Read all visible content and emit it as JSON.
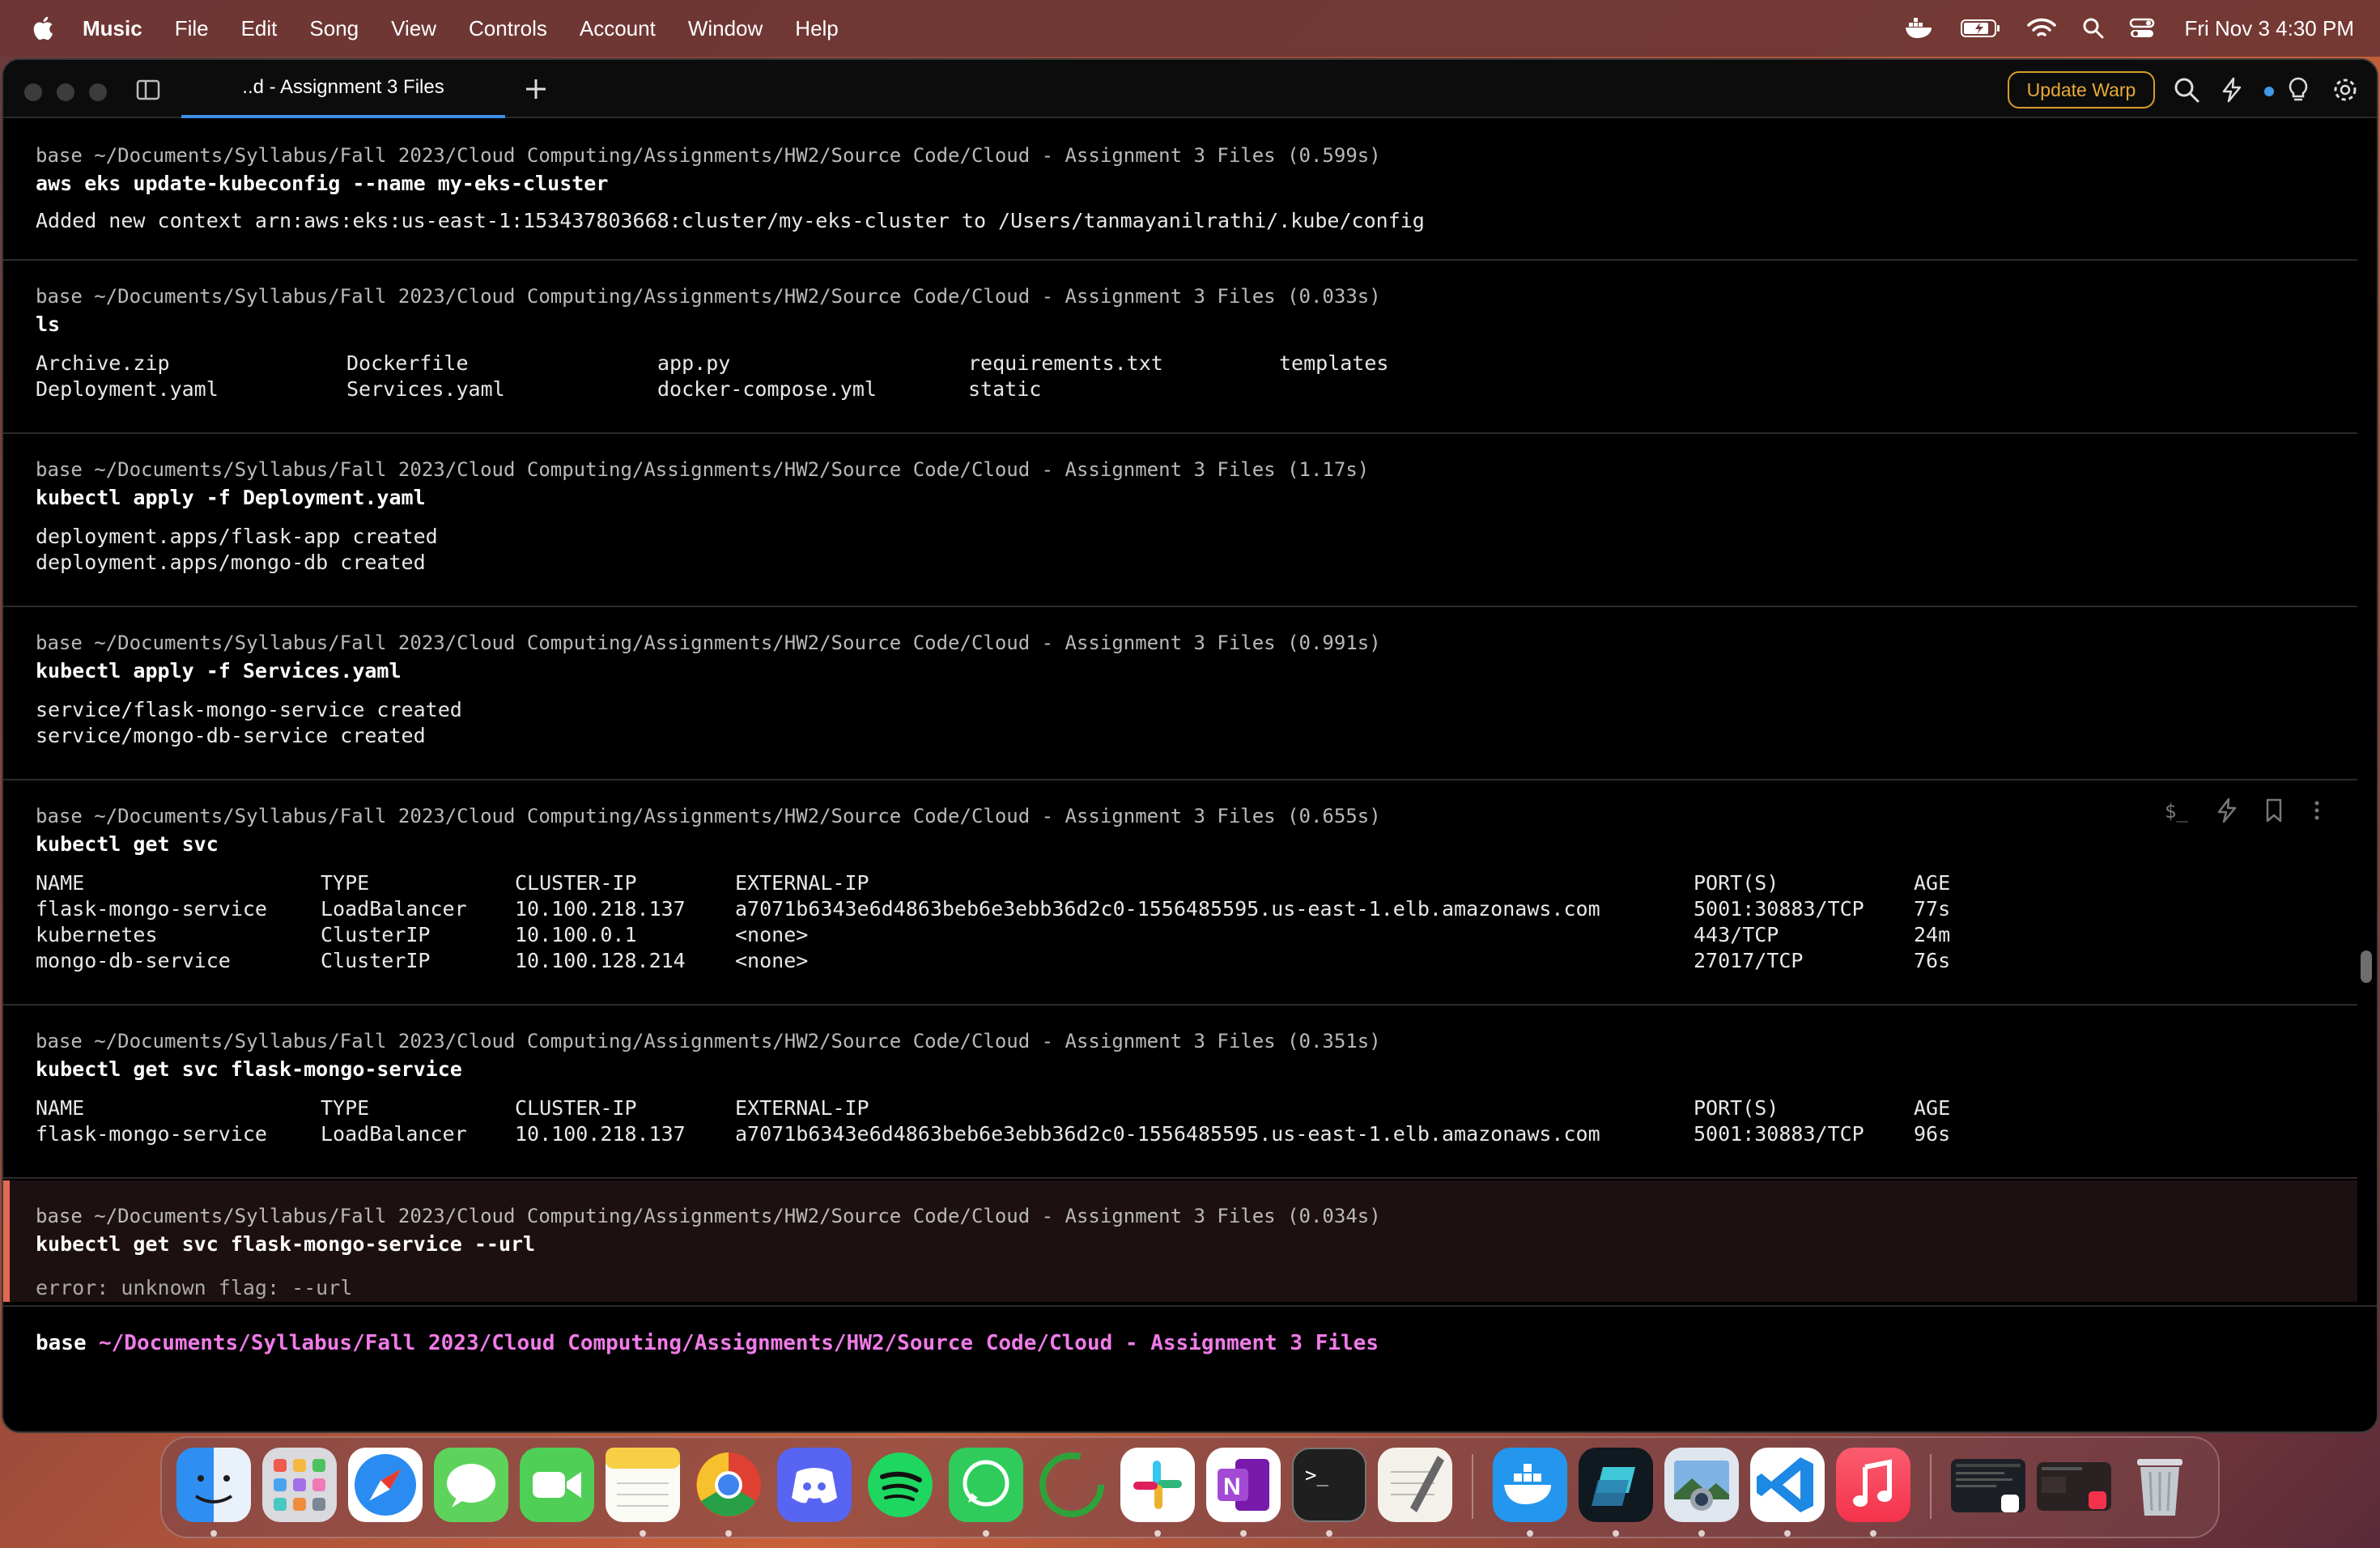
{
  "menubar": {
    "items": [
      "Music",
      "File",
      "Edit",
      "Song",
      "View",
      "Controls",
      "Account",
      "Window",
      "Help"
    ],
    "icons": [
      "apple-icon",
      "docker-whale-icon",
      "battery-icon",
      "wifi-icon",
      "spotlight-search-icon",
      "control-center-icon"
    ],
    "clock": "Fri Nov 3  4:30 PM"
  },
  "window": {
    "tab_title": "..d - Assignment 3 Files",
    "update_button": "Update Warp",
    "toolbar_icons": [
      "search-icon",
      "lightning-icon",
      "status-dot-icon",
      "lightbulb-icon",
      "gear-icon"
    ]
  },
  "blocks": [
    {
      "meta": "base ~/Documents/Syllabus/Fall 2023/Cloud Computing/Assignments/HW2/Source Code/Cloud - Assignment 3 Files (0.599s)",
      "command": "aws eks update-kubeconfig --name my-eks-cluster",
      "output": [
        "Added new context arn:aws:eks:us-east-1:153437803668:cluster/my-eks-cluster to /Users/tanmayanilrathi/.kube/config"
      ]
    },
    {
      "meta": "base ~/Documents/Syllabus/Fall 2023/Cloud Computing/Assignments/HW2/Source Code/Cloud - Assignment 3 Files (0.033s)",
      "command": "ls",
      "files": [
        [
          "Archive.zip",
          "Dockerfile",
          "app.py",
          "requirements.txt",
          "templates"
        ],
        [
          "Deployment.yaml",
          "Services.yaml",
          "docker-compose.yml",
          "static",
          ""
        ]
      ]
    },
    {
      "meta": "base ~/Documents/Syllabus/Fall 2023/Cloud Computing/Assignments/HW2/Source Code/Cloud - Assignment 3 Files (1.17s)",
      "command": "kubectl apply -f Deployment.yaml",
      "output": [
        "deployment.apps/flask-app created",
        "deployment.apps/mongo-db created"
      ]
    },
    {
      "meta": "base ~/Documents/Syllabus/Fall 2023/Cloud Computing/Assignments/HW2/Source Code/Cloud - Assignment 3 Files (0.991s)",
      "command": "kubectl apply -f Services.yaml",
      "output": [
        "service/flask-mongo-service created",
        "service/mongo-db-service created"
      ]
    },
    {
      "meta": "base ~/Documents/Syllabus/Fall 2023/Cloud Computing/Assignments/HW2/Source Code/Cloud - Assignment 3 Files (0.655s)",
      "command": "kubectl get svc",
      "table": {
        "headers": [
          "NAME",
          "TYPE",
          "CLUSTER-IP",
          "EXTERNAL-IP",
          "PORT(S)",
          "AGE"
        ],
        "rows": [
          [
            "flask-mongo-service",
            "LoadBalancer",
            "10.100.218.137",
            "a7071b6343e6d4863beb6e3ebb36d2c0-1556485595.us-east-1.elb.amazonaws.com",
            "5001:30883/TCP",
            "77s"
          ],
          [
            "kubernetes",
            "ClusterIP",
            "10.100.0.1",
            "<none>",
            "443/TCP",
            "24m"
          ],
          [
            "mongo-db-service",
            "ClusterIP",
            "10.100.128.214",
            "<none>",
            "27017/TCP",
            "76s"
          ]
        ]
      }
    },
    {
      "meta": "base ~/Documents/Syllabus/Fall 2023/Cloud Computing/Assignments/HW2/Source Code/Cloud - Assignment 3 Files (0.351s)",
      "command": "kubectl get svc flask-mongo-service",
      "table": {
        "headers": [
          "NAME",
          "TYPE",
          "CLUSTER-IP",
          "EXTERNAL-IP",
          "PORT(S)",
          "AGE"
        ],
        "rows": [
          [
            "flask-mongo-service",
            "LoadBalancer",
            "10.100.218.137",
            "a7071b6343e6d4863beb6e3ebb36d2c0-1556485595.us-east-1.elb.amazonaws.com",
            "5001:30883/TCP",
            "96s"
          ]
        ]
      }
    },
    {
      "meta": "base ~/Documents/Syllabus/Fall 2023/Cloud Computing/Assignments/HW2/Source Code/Cloud - Assignment 3 Files (0.034s)",
      "command": "kubectl get svc flask-mongo-service --url",
      "output": [
        "error: unknown flag: --url"
      ]
    }
  ],
  "block_actions": [
    "dollar-prompt-icon",
    "lightning-icon",
    "bookmark-icon",
    "more-options-icon"
  ],
  "prompt": {
    "env": "base",
    "path": "~/Documents/Syllabus/Fall 2023/Cloud Computing/Assignments/HW2/Source Code/Cloud - Assignment 3 Files"
  },
  "dock": {
    "apps": [
      "finder-icon",
      "launchpad-icon",
      "safari-icon",
      "messages-icon",
      "facetime-icon",
      "notes-icon",
      "chrome-icon",
      "discord-icon",
      "spotify-icon",
      "whatsapp-icon",
      "loading-app-icon",
      "slack-icon",
      "onenote-icon",
      "terminal-icon",
      "textedit-icon",
      "docker-icon",
      "warp-icon",
      "preview-icon",
      "vscode-icon",
      "music-icon",
      "window-thumbnail-warp",
      "window-thumbnail-music",
      "trash-icon"
    ]
  }
}
